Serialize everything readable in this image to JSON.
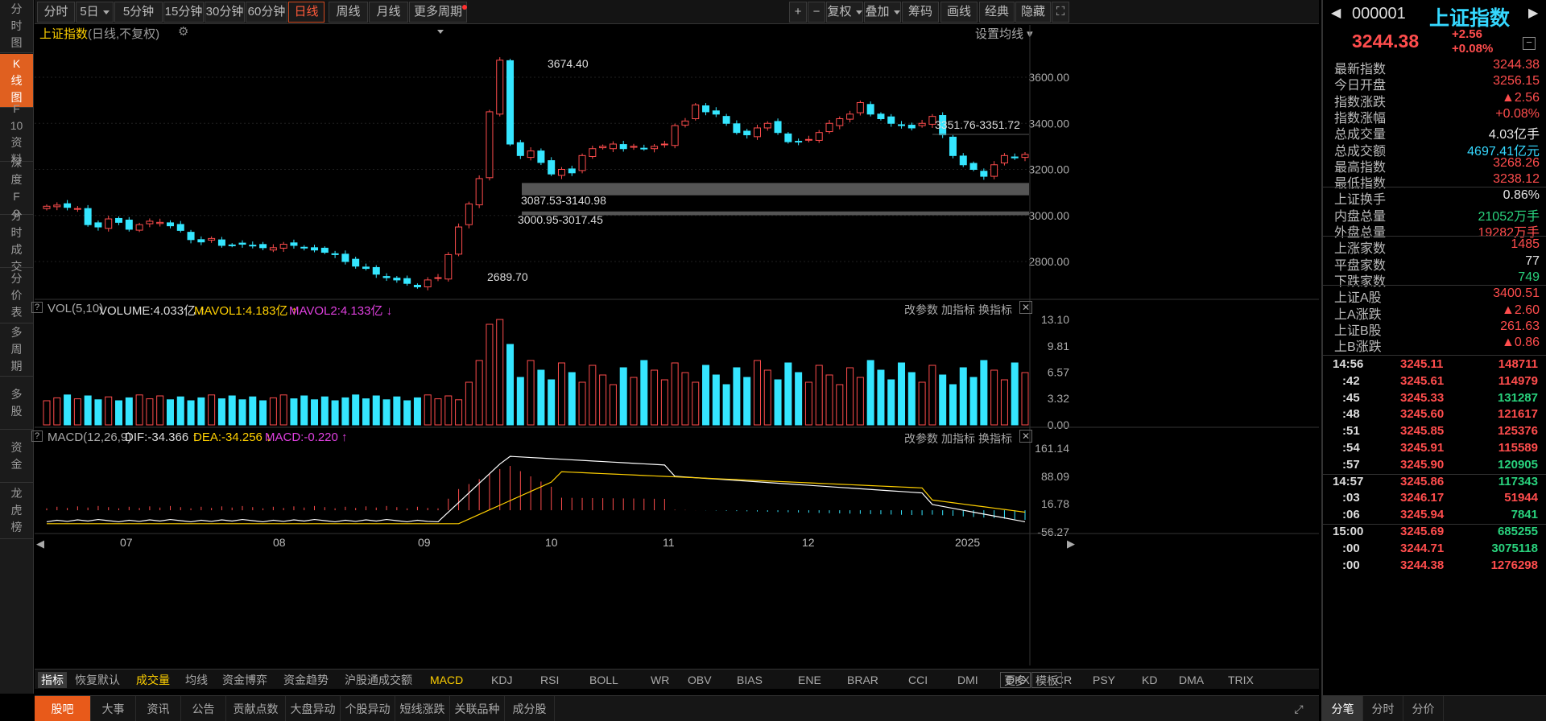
{
  "left_nav": [
    {
      "label": "分时图"
    },
    {
      "label": "K线图",
      "active": true
    },
    {
      "label": "F10资料"
    },
    {
      "label": "深度F9"
    },
    {
      "label": "分时成交"
    },
    {
      "label": "分价表"
    },
    {
      "label": "多周期"
    },
    {
      "label": "多股"
    },
    {
      "label": "资金"
    },
    {
      "label": "龙虎榜"
    }
  ],
  "toolbar": {
    "periods": [
      "分时",
      "5日",
      "5分钟",
      "15分钟",
      "30分钟",
      "60分钟",
      "日线",
      "周线",
      "月线",
      "更多周期"
    ],
    "active_period": "日线",
    "right": [
      "+",
      "−",
      "复权",
      "叠加",
      "筹码",
      "画线",
      "经典",
      "隐藏"
    ]
  },
  "chart_header": {
    "title": "上证指数",
    "subtitle": "(日线,不复权)",
    "ma_setting": "设置均线"
  },
  "main_chart": {
    "y_ticks": [
      "3600.00",
      "3400.00",
      "3200.00",
      "3000.00",
      "2800.00"
    ],
    "annotations": [
      "3674.40",
      "2689.70",
      "3351.76-3351.72",
      "3087.53-3140.98",
      "3000.95-3017.45"
    ]
  },
  "vol_panel": {
    "name": "VOL(5,10)",
    "volume": "VOLUME:4.033亿",
    "mavol1": "MAVOL1:4.183亿",
    "mavol2": "MAVOL2:4.133亿",
    "y_ticks": [
      "13.10",
      "9.81",
      "6.57",
      "3.32",
      "0.00"
    ],
    "actions": [
      "改参数",
      "加指标",
      "换指标"
    ]
  },
  "macd_panel": {
    "name": "MACD(12,26,9)",
    "dif": "DIF:-34.366",
    "dea": "DEA:-34.256",
    "macd": "MACD:-0.220",
    "y_ticks": [
      "161.14",
      "88.09",
      "16.78",
      "-56.27"
    ],
    "actions": [
      "改参数",
      "加指标",
      "换指标"
    ]
  },
  "x_labels": [
    "07",
    "08",
    "09",
    "10",
    "11",
    "12",
    "2025"
  ],
  "indicator_tabs": [
    "指标",
    "恢复默认",
    "成交量",
    "均线",
    "资金博弈",
    "资金趋势",
    "沪股通成交额",
    "MACD",
    "KDJ",
    "RSI",
    "BOLL",
    "WR",
    "OBV",
    "BIAS",
    "ENE",
    "BRAR",
    "CCI",
    "DMI",
    "DKX",
    "CR",
    "PSY",
    "KD",
    "DMA",
    "TRIX",
    "更多",
    "模板"
  ],
  "bottom_tabs": [
    "股吧",
    "大事",
    "资讯",
    "公告",
    "贡献点数",
    "大盘异动",
    "个股异动",
    "短线涨跌",
    "关联品种",
    "成分股"
  ],
  "quote": {
    "code": "000001",
    "name": "上证指数",
    "price": "3244.38",
    "change": "+2.56",
    "change_pct": "+0.08%",
    "rows": [
      {
        "k": "最新指数",
        "v": "3244.38",
        "c": "red"
      },
      {
        "k": "今日开盘",
        "v": "3256.15",
        "c": "red"
      },
      {
        "k": "指数涨跌",
        "v": "▲2.56",
        "c": "red"
      },
      {
        "k": "指数涨幅",
        "v": "+0.08%",
        "c": "red"
      },
      {
        "k": "总成交量",
        "v": "4.03亿手",
        "c": "white"
      },
      {
        "k": "总成交额",
        "v": "4697.41亿元",
        "c": "cyan"
      },
      {
        "k": "最高指数",
        "v": "3268.26",
        "c": "red"
      },
      {
        "k": "最低指数",
        "v": "3238.12",
        "c": "red"
      },
      {
        "k": "上证换手",
        "v": "0.86%",
        "c": "white"
      },
      {
        "k": "内盘总量",
        "v": "21052万手",
        "c": "green"
      },
      {
        "k": "外盘总量",
        "v": "19282万手",
        "c": "red"
      },
      {
        "k": "上涨家数",
        "v": "1485",
        "c": "red"
      },
      {
        "k": "平盘家数",
        "v": "77",
        "c": "white"
      },
      {
        "k": "下跌家数",
        "v": "749",
        "c": "green"
      },
      {
        "k": "上证A股",
        "v": "3400.51",
        "c": "red"
      },
      {
        "k": "上A涨跌",
        "v": "▲2.60",
        "c": "red"
      },
      {
        "k": "上证B股",
        "v": "261.63",
        "c": "red"
      },
      {
        "k": "上B涨跌",
        "v": "▲0.86",
        "c": "red"
      }
    ],
    "ticks": [
      {
        "t": "14:56",
        "p": "3245.11",
        "q": "148711",
        "c": "red"
      },
      {
        "t": ":42",
        "p": "3245.61",
        "q": "114979",
        "c": "red"
      },
      {
        "t": ":45",
        "p": "3245.33",
        "q": "131287",
        "c": "green"
      },
      {
        "t": ":48",
        "p": "3245.60",
        "q": "121617",
        "c": "red"
      },
      {
        "t": ":51",
        "p": "3245.85",
        "q": "125376",
        "c": "red"
      },
      {
        "t": ":54",
        "p": "3245.91",
        "q": "115589",
        "c": "red"
      },
      {
        "t": ":57",
        "p": "3245.90",
        "q": "120905",
        "c": "green"
      },
      {
        "t": "14:57",
        "p": "3245.86",
        "q": "117343",
        "c": "green"
      },
      {
        "t": ":03",
        "p": "3246.17",
        "q": "51944",
        "c": "red"
      },
      {
        "t": ":06",
        "p": "3245.94",
        "q": "7841",
        "c": "green"
      },
      {
        "t": "15:00",
        "p": "3245.69",
        "q": "685255",
        "c": "green"
      },
      {
        "t": ":00",
        "p": "3244.71",
        "q": "3075118",
        "c": "green"
      },
      {
        "t": ":00",
        "p": "3244.38",
        "q": "1276298",
        "c": "red"
      }
    ],
    "tabs": [
      "分笔",
      "分时",
      "分价"
    ]
  }
}
